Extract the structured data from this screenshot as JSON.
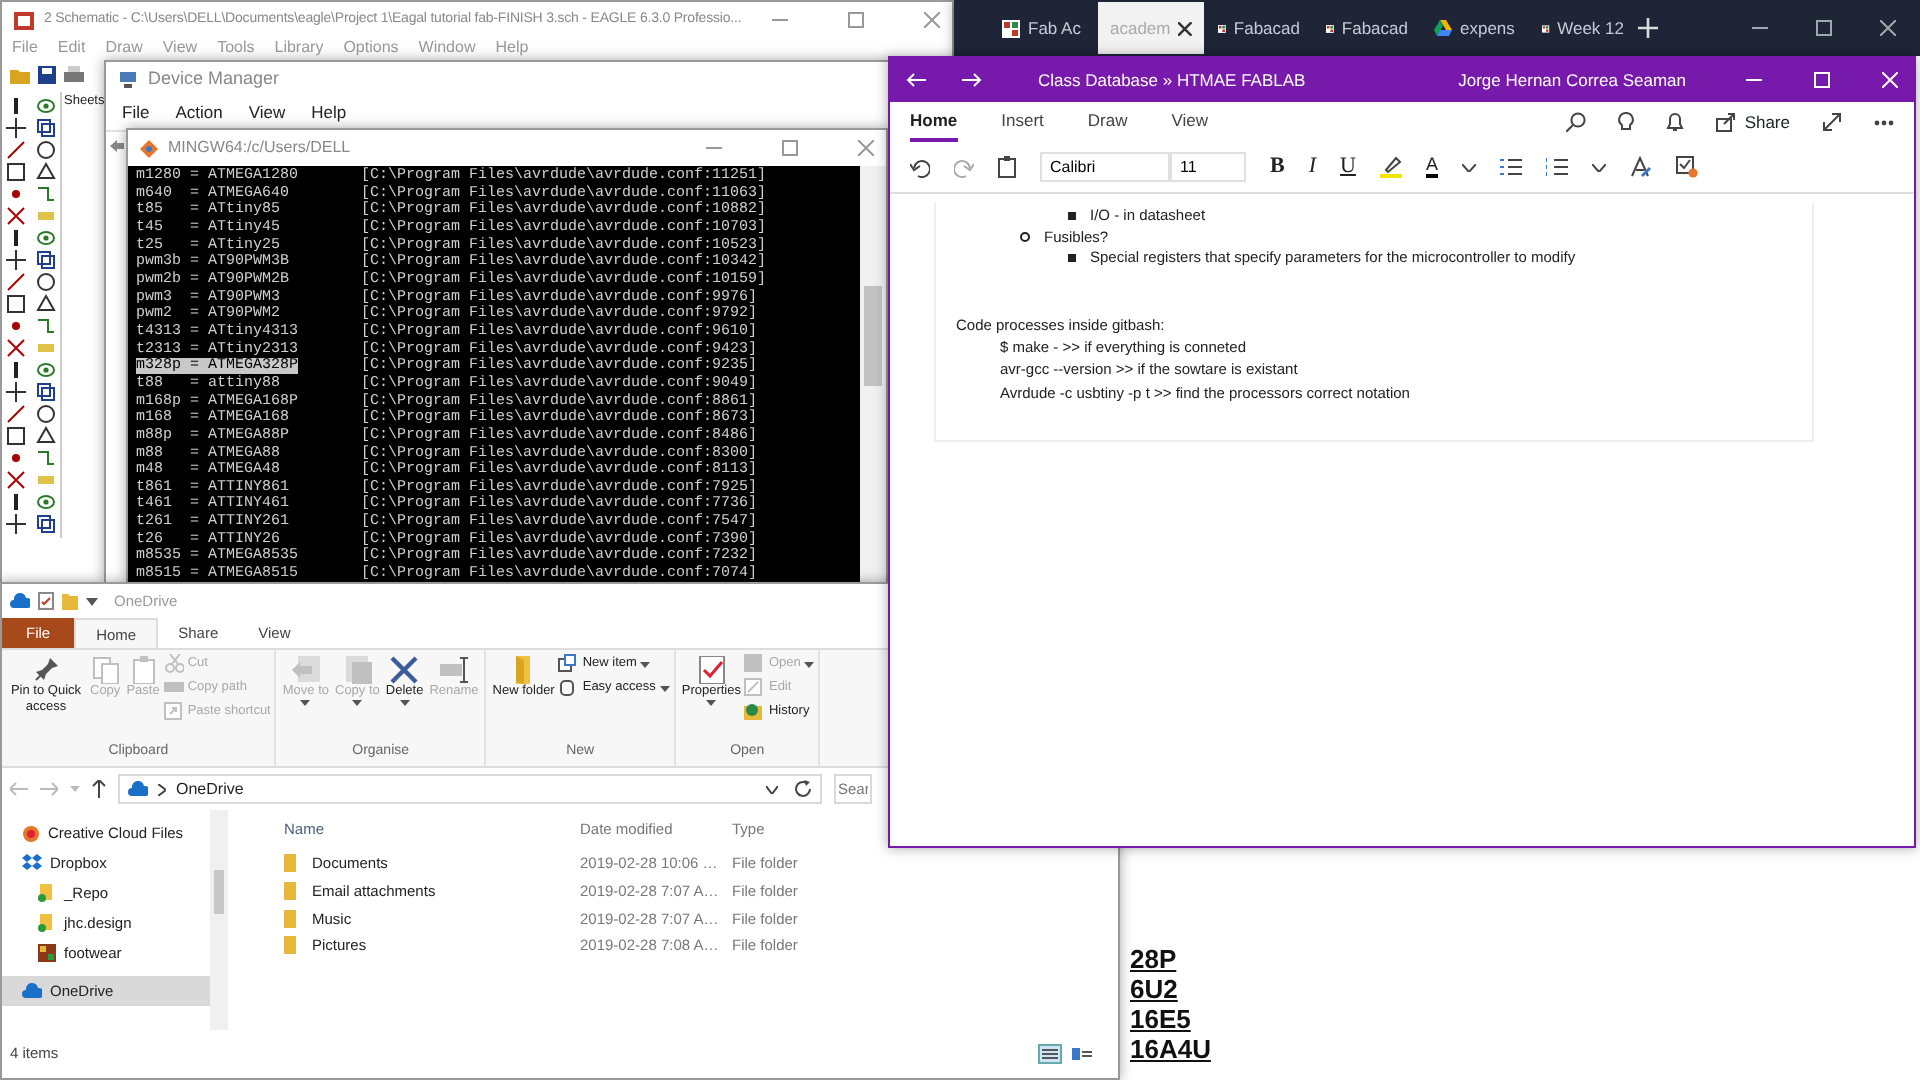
{
  "eagle_window": {
    "title": "2 Schematic - C:\\Users\\DELL\\Documents\\eagle\\Project 1\\Eagal tutorial fab-FINISH 3.sch - EAGLE 6.3.0 Professio...",
    "menu": [
      "File",
      "Edit",
      "Draw",
      "View",
      "Tools",
      "Library",
      "Options",
      "Window",
      "Help"
    ],
    "sheets_label": "Sheets"
  },
  "device_manager": {
    "title": "Device Manager",
    "menu": [
      "File",
      "Action",
      "View",
      "Help"
    ]
  },
  "terminal": {
    "title": "MINGW64:/c/Users/DELL",
    "lines": [
      {
        "part": "m1280 = ATMEGA1280",
        "config": "[C:\\Program Files\\avrdude\\avrdude.conf:11251]",
        "selected": false
      },
      {
        "part": "m640  = ATMEGA640",
        "config": "[C:\\Program Files\\avrdude\\avrdude.conf:11063]",
        "selected": false
      },
      {
        "part": "t85   = ATtiny85",
        "config": "[C:\\Program Files\\avrdude\\avrdude.conf:10882]",
        "selected": false
      },
      {
        "part": "t45   = ATtiny45",
        "config": "[C:\\Program Files\\avrdude\\avrdude.conf:10703]",
        "selected": false
      },
      {
        "part": "t25   = ATtiny25",
        "config": "[C:\\Program Files\\avrdude\\avrdude.conf:10523]",
        "selected": false
      },
      {
        "part": "pwm3b = AT90PWM3B",
        "config": "[C:\\Program Files\\avrdude\\avrdude.conf:10342]",
        "selected": false
      },
      {
        "part": "pwm2b = AT90PWM2B",
        "config": "[C:\\Program Files\\avrdude\\avrdude.conf:10159]",
        "selected": false
      },
      {
        "part": "pwm3  = AT90PWM3",
        "config": "[C:\\Program Files\\avrdude\\avrdude.conf:9976]",
        "selected": false
      },
      {
        "part": "pwm2  = AT90PWM2",
        "config": "[C:\\Program Files\\avrdude\\avrdude.conf:9792]",
        "selected": false
      },
      {
        "part": "t4313 = ATtiny4313",
        "config": "[C:\\Program Files\\avrdude\\avrdude.conf:9610]",
        "selected": false
      },
      {
        "part": "t2313 = ATtiny2313",
        "config": "[C:\\Program Files\\avrdude\\avrdude.conf:9423]",
        "selected": false
      },
      {
        "part": "m328p = ATMEGA328P",
        "config": "[C:\\Program Files\\avrdude\\avrdude.conf:9235]",
        "selected": true
      },
      {
        "part": "t88   = attiny88",
        "config": "[C:\\Program Files\\avrdude\\avrdude.conf:9049]",
        "selected": false
      },
      {
        "part": "m168p = ATMEGA168P",
        "config": "[C:\\Program Files\\avrdude\\avrdude.conf:8861]",
        "selected": false
      },
      {
        "part": "m168  = ATMEGA168",
        "config": "[C:\\Program Files\\avrdude\\avrdude.conf:8673]",
        "selected": false
      },
      {
        "part": "m88p  = ATMEGA88P",
        "config": "[C:\\Program Files\\avrdude\\avrdude.conf:8486]",
        "selected": false
      },
      {
        "part": "m88   = ATMEGA88",
        "config": "[C:\\Program Files\\avrdude\\avrdude.conf:8300]",
        "selected": false
      },
      {
        "part": "m48   = ATMEGA48",
        "config": "[C:\\Program Files\\avrdude\\avrdude.conf:8113]",
        "selected": false
      },
      {
        "part": "t861  = ATTINY861",
        "config": "[C:\\Program Files\\avrdude\\avrdude.conf:7925]",
        "selected": false
      },
      {
        "part": "t461  = ATTINY461",
        "config": "[C:\\Program Files\\avrdude\\avrdude.conf:7736]",
        "selected": false
      },
      {
        "part": "t261  = ATTINY261",
        "config": "[C:\\Program Files\\avrdude\\avrdude.conf:7547]",
        "selected": false
      },
      {
        "part": "t26   = ATTINY26",
        "config": "[C:\\Program Files\\avrdude\\avrdude.conf:7390]",
        "selected": false
      },
      {
        "part": "m8535 = ATMEGA8535",
        "config": "[C:\\Program Files\\avrdude\\avrdude.conf:7232]",
        "selected": false
      },
      {
        "part": "m8515 = ATMEGA8515",
        "config": "[C:\\Program Files\\avrdude\\avrdude.conf:7074]",
        "selected": false
      }
    ]
  },
  "browser": {
    "tabs": [
      {
        "label": "Fab Ac",
        "kind": "site",
        "selected": false
      },
      {
        "label": "academ",
        "kind": "plain",
        "selected": true
      },
      {
        "label": "Fabacad",
        "kind": "site",
        "selected": false
      },
      {
        "label": "Fabacad",
        "kind": "site",
        "selected": false
      },
      {
        "label": "expens",
        "kind": "drive",
        "selected": false
      },
      {
        "label": "Week 12",
        "kind": "site",
        "selected": false
      }
    ],
    "page_lines": [
      "28P",
      "6U2",
      "16E5",
      "16A4U"
    ]
  },
  "onenote": {
    "breadcrumb": "Class Database » HTMAE FABLAB",
    "user": "Jorge Hernan Correa Seaman",
    "tabs": [
      {
        "label": "Home",
        "selected": true
      },
      {
        "label": "Insert",
        "selected": false
      },
      {
        "label": "Draw",
        "selected": false
      },
      {
        "label": "View",
        "selected": false
      }
    ],
    "share_label": "Share",
    "font_name": "Calibri",
    "font_size": "11",
    "format_buttons": [
      {
        "label": "B",
        "kind": "bold"
      },
      {
        "label": "I",
        "kind": "italic"
      },
      {
        "label": "U",
        "kind": "underline"
      }
    ],
    "font_color_label": "A",
    "outline": [
      {
        "children": [
          {
            "text": "I/O - in datasheet"
          }
        ]
      },
      {
        "text": "Fusibles?",
        "children": [
          {
            "text": "Special registers that specify parameters for the microcontroller to modify"
          }
        ]
      }
    ],
    "code_heading": "Code processes inside gitbash:",
    "code_lines": [
      "$ make -  >> if everything is conneted",
      "avr-gcc --version >>  if the sowtare is existant",
      "Avrdude -c usbtiny -p t >> find the processors correct notation"
    ]
  },
  "explorer": {
    "title": "OneDrive",
    "tabs": [
      {
        "label": "File",
        "kind": "file",
        "selected": false
      },
      {
        "label": "Home",
        "kind": "tab",
        "selected": true
      },
      {
        "label": "Share",
        "kind": "tab",
        "selected": false
      },
      {
        "label": "View",
        "kind": "tab",
        "selected": false
      }
    ],
    "ribbon_groups": [
      {
        "label": "Clipboard",
        "items": [
          {
            "label": "Pin to Quick access",
            "kind": "large",
            "disabled": false,
            "dropdown": false
          },
          {
            "label": "Copy",
            "kind": "large",
            "disabled": true,
            "dropdown": false
          },
          {
            "label": "Paste",
            "kind": "large",
            "disabled": true,
            "dropdown": false
          },
          {
            "label": "Cut",
            "kind": "small",
            "disabled": true,
            "dropdown": false
          },
          {
            "label": "Copy path",
            "kind": "small",
            "disabled": true,
            "dropdown": false
          },
          {
            "label": "Paste shortcut",
            "kind": "small",
            "disabled": true,
            "dropdown": false
          }
        ]
      },
      {
        "label": "Organise",
        "items": [
          {
            "label": "Move to",
            "kind": "large",
            "disabled": true,
            "dropdown": true
          },
          {
            "label": "Copy to",
            "kind": "large",
            "disabled": true,
            "dropdown": true
          },
          {
            "label": "Delete",
            "kind": "large",
            "disabled": false,
            "dropdown": true
          },
          {
            "label": "Rename",
            "kind": "large",
            "disabled": true,
            "dropdown": false
          }
        ]
      },
      {
        "label": "New",
        "items": [
          {
            "label": "New folder",
            "kind": "large",
            "disabled": false,
            "dropdown": false
          },
          {
            "label": "New item",
            "kind": "small",
            "disabled": false,
            "dropdown": true
          },
          {
            "label": "Easy access",
            "kind": "small",
            "disabled": false,
            "dropdown": true
          }
        ]
      },
      {
        "label": "Open",
        "items": [
          {
            "label": "Properties",
            "kind": "large",
            "disabled": false,
            "dropdown": true
          },
          {
            "label": "Open",
            "kind": "small",
            "disabled": true,
            "dropdown": true
          },
          {
            "label": "Edit",
            "kind": "small",
            "disabled": true,
            "dropdown": false
          },
          {
            "label": "History",
            "kind": "small",
            "disabled": false,
            "dropdown": false
          }
        ]
      }
    ],
    "address": "OneDrive",
    "search_placeholder": "Sear",
    "nav_items": [
      {
        "label": "Creative Cloud Files",
        "kind": "cloud-files",
        "selected": false
      },
      {
        "label": "Dropbox",
        "kind": "dropbox",
        "selected": false,
        "children": [
          {
            "label": "_Repo",
            "kind": "synced-folder",
            "selected": false
          },
          {
            "label": "jhc.design",
            "kind": "synced-folder",
            "selected": false
          },
          {
            "label": "footwear",
            "kind": "image-folder",
            "selected": false
          }
        ]
      },
      {
        "label": "OneDrive",
        "kind": "onedrive",
        "selected": true
      }
    ],
    "columns": [
      "Name",
      "Date modified",
      "Type"
    ],
    "rows": [
      {
        "name": "Documents",
        "date": "2019-02-28 10:06 …",
        "type": "File folder"
      },
      {
        "name": "Email attachments",
        "date": "2019-02-28 7:07 A…",
        "type": "File folder"
      },
      {
        "name": "Music",
        "date": "2019-02-28 7:07 A…",
        "type": "File folder"
      },
      {
        "name": "Pictures",
        "date": "2019-02-28 7:08 A…",
        "type": "File folder"
      }
    ],
    "status": "4 items"
  }
}
